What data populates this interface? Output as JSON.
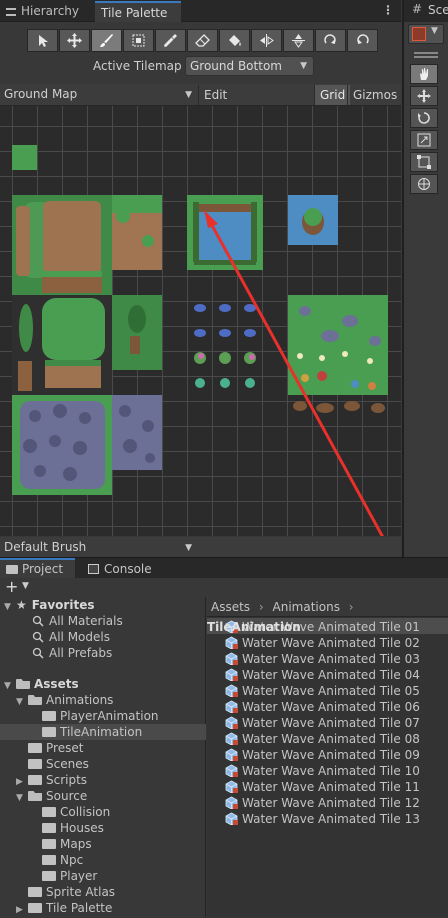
{
  "tabs": {
    "hierarchy": "Hierarchy",
    "tile_palette": "Tile Palette",
    "scene_partial": "Sce"
  },
  "tools": [
    "select",
    "move",
    "paint",
    "box-fill",
    "pick",
    "erase",
    "flood-fill",
    "rotate-left",
    "rotate-right",
    "flip-x",
    "flip-y"
  ],
  "active_tilemap": {
    "label": "Active Tilemap",
    "value": "Ground Bottom"
  },
  "palette": {
    "name": "Ground Map",
    "edit_label": "Edit",
    "grid_label": "Grid",
    "gizmos_label": "Gizmos"
  },
  "brush": {
    "value": "Default Brush"
  },
  "bottom_tabs": {
    "project": "Project",
    "console": "Console"
  },
  "tree": {
    "favorites": "Favorites",
    "fav_items": [
      "All Materials",
      "All Models",
      "All Prefabs"
    ],
    "assets": "Assets",
    "items": [
      {
        "label": "Animations",
        "indent": 1,
        "open": true,
        "arrow": "down"
      },
      {
        "label": "PlayerAnimation",
        "indent": 2,
        "open": false,
        "arrow": ""
      },
      {
        "label": "TileAnimation",
        "indent": 2,
        "open": false,
        "arrow": "",
        "selected": true
      },
      {
        "label": "Preset",
        "indent": 1,
        "open": false,
        "arrow": ""
      },
      {
        "label": "Scenes",
        "indent": 1,
        "open": false,
        "arrow": ""
      },
      {
        "label": "Scripts",
        "indent": 1,
        "open": false,
        "arrow": "right"
      },
      {
        "label": "Source",
        "indent": 1,
        "open": true,
        "arrow": "down"
      },
      {
        "label": "Collision",
        "indent": 2,
        "open": false,
        "arrow": ""
      },
      {
        "label": "Houses",
        "indent": 2,
        "open": false,
        "arrow": ""
      },
      {
        "label": "Maps",
        "indent": 2,
        "open": false,
        "arrow": ""
      },
      {
        "label": "Npc",
        "indent": 2,
        "open": false,
        "arrow": ""
      },
      {
        "label": "Player",
        "indent": 2,
        "open": false,
        "arrow": ""
      },
      {
        "label": "Sprite Atlas",
        "indent": 1,
        "open": false,
        "arrow": ""
      },
      {
        "label": "Tile Palette",
        "indent": 1,
        "open": false,
        "arrow": "right"
      }
    ]
  },
  "breadcrumb": [
    "Assets",
    "Animations",
    "TileAnimation"
  ],
  "files": [
    "Water Wave Animated Tile 01",
    "Water Wave Animated Tile 02",
    "Water Wave Animated Tile 03",
    "Water Wave Animated Tile 04",
    "Water Wave Animated Tile 05",
    "Water Wave Animated Tile 06",
    "Water Wave Animated Tile 07",
    "Water Wave Animated Tile 08",
    "Water Wave Animated Tile 09",
    "Water Wave Animated Tile 10",
    "Water Wave Animated Tile 11",
    "Water Wave Animated Tile 12",
    "Water Wave Animated Tile 13"
  ],
  "colors": {
    "accent": "#3a79bb",
    "grass": "#4a9e52",
    "dirt": "#9e7350",
    "water": "#4e8cc4",
    "rock": "#6d7096",
    "arrow": "#e8312a"
  }
}
